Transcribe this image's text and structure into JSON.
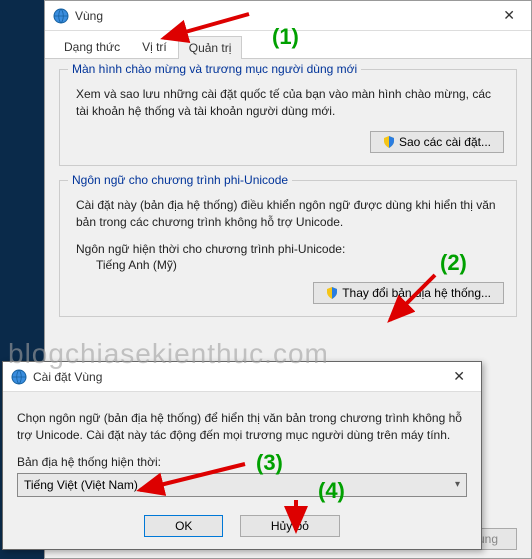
{
  "win1": {
    "title": "Vùng",
    "tabs": {
      "format": "Dạng thức",
      "location": "Vị trí",
      "admin": "Quản trị"
    },
    "group1": {
      "title": "Màn hình chào mừng và trương mục người dùng mới",
      "desc": "Xem và sao lưu những cài đặt quốc tế của bạn vào màn hình chào mừng, các tài khoản hệ thống và tài khoản người dùng mới.",
      "button": "Sao các cài đặt..."
    },
    "group2": {
      "title": "Ngôn ngữ cho chương trình phi-Unicode",
      "desc": "Cài đặt này (bản địa hệ thống) điều khiển ngôn ngữ được dùng khi hiển thị văn bản trong các chương trình không hỗ trợ Unicode.",
      "cur_label": "Ngôn ngữ hiện thời cho chương trình phi-Unicode:",
      "cur_value": "Tiếng Anh (Mỹ)",
      "button": "Thay đổi bản địa hệ thống..."
    },
    "footer": {
      "apply": "Áp dụng"
    }
  },
  "win2": {
    "title": "Cài đặt Vùng",
    "desc": "Chọn ngôn ngữ (bản địa hệ thống) để hiển thị văn bản trong chương trình không hỗ trợ Unicode. Cài đặt này tác động đến mọi trương mục người dùng trên máy tính.",
    "combo_label": "Bản địa hệ thống hiện thời:",
    "combo_value": "Tiếng Việt (Việt Nam)",
    "ok": "OK",
    "cancel": "Hủy bỏ"
  },
  "annot": {
    "n1": "(1)",
    "n2": "(2)",
    "n3": "(3)",
    "n4": "(4)"
  },
  "watermark": "blogchiasekienthuc.com"
}
